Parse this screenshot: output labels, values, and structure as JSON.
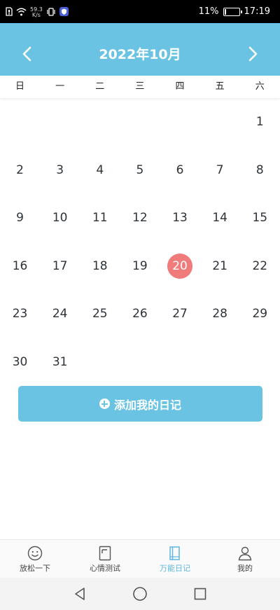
{
  "status_bar": {
    "net_speed": "59.3",
    "net_unit": "K/s",
    "battery": "11%",
    "battery_level": 0.11,
    "time": "17:19"
  },
  "header": {
    "title": "2022年10月",
    "color": "#6ac3e3"
  },
  "weekdays": [
    "日",
    "一",
    "二",
    "三",
    "四",
    "五",
    "六"
  ],
  "calendar": {
    "leading_blanks": 6,
    "days": [
      "1",
      "2",
      "3",
      "4",
      "5",
      "6",
      "7",
      "8",
      "9",
      "10",
      "11",
      "12",
      "13",
      "14",
      "15",
      "16",
      "17",
      "18",
      "19",
      "20",
      "21",
      "22",
      "23",
      "24",
      "25",
      "26",
      "27",
      "28",
      "29",
      "30",
      "31"
    ],
    "today": "20",
    "today_color": "#f07b7b"
  },
  "add_button": {
    "label": "添加我的日记"
  },
  "tabs": [
    {
      "label": "放松一下",
      "icon": "smiley-icon",
      "active": false
    },
    {
      "label": "心情测试",
      "icon": "document-icon",
      "active": false
    },
    {
      "label": "万能日记",
      "icon": "notebook-icon",
      "active": true
    },
    {
      "label": "我的",
      "icon": "user-icon",
      "active": false
    }
  ],
  "system_nav": {
    "icons": [
      "back-triangle-icon",
      "home-circle-icon",
      "recents-square-icon"
    ]
  }
}
